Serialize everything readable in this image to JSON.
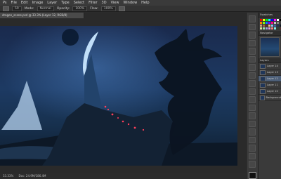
{
  "app": {
    "name": "Photoshop"
  },
  "menu": [
    "Ps",
    "File",
    "Edit",
    "Image",
    "Layer",
    "Type",
    "Select",
    "Filter",
    "3D",
    "View",
    "Window",
    "Help"
  ],
  "options": {
    "brush_size": "59",
    "mode_label": "Mode:",
    "mode_value": "Normal",
    "opacity_label": "Opacity:",
    "opacity_value": "100%",
    "flow_label": "Flow:",
    "flow_value": "100%"
  },
  "document": {
    "tab": "dragon_scene.psd @ 33.3% (Layer 12, RGB/8)"
  },
  "status": {
    "zoom": "33.33%",
    "doc": "Doc: 24.9M/186.4M"
  },
  "panels": {
    "swatches_title": "Swatches",
    "navigator_title": "Navigator",
    "layers_title": "Layers",
    "swatch_colors": [
      "#ff0000",
      "#ffff00",
      "#00ff00",
      "#00ffff",
      "#0000ff",
      "#ff00ff",
      "#ffffff",
      "#000000",
      "#ff7f00",
      "#7fff00",
      "#007fff",
      "#7f00ff",
      "#ff007f",
      "#bfbfbf",
      "#808080",
      "#404040",
      "#c0a080",
      "#a06040",
      "#603020",
      "#f0c080",
      "#80c0f0",
      "#4060a0",
      "#203050",
      "#101820",
      "#e0e0a0",
      "#a0e0a0",
      "#a0a0e0",
      "#e0a0e0",
      "#f08080",
      "#80f0f0",
      "#304030",
      "#503030"
    ],
    "layers": [
      "Layer 14",
      "Layer 13",
      "Layer 12",
      "Layer 11",
      "Layer 10",
      "Background"
    ]
  },
  "colors": {
    "sky": "#1d3a63",
    "moon": "#c9e7ff",
    "lava": "#ff3f5a"
  }
}
